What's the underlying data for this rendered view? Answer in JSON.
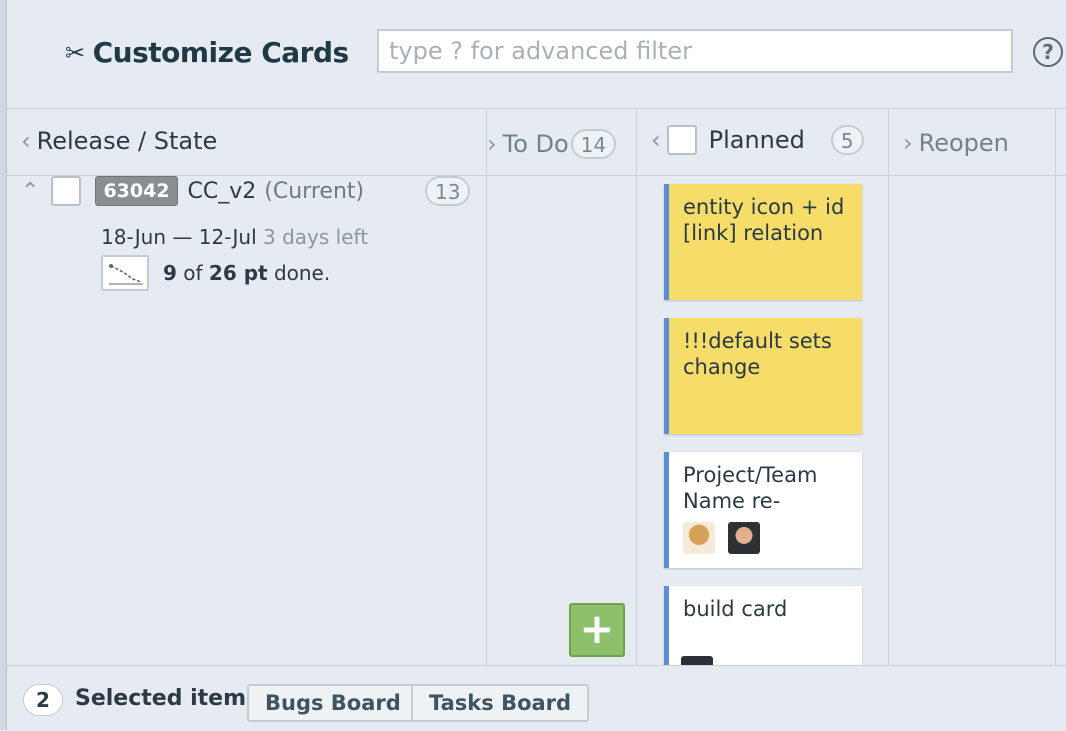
{
  "header": {
    "title": "Customize Cards",
    "title_icon": "scissors-icon",
    "filter_placeholder": "type ? for advanced filter",
    "help_label": "?"
  },
  "columns": {
    "release_state": {
      "label": "Release / State"
    },
    "todo": {
      "label": "To Do",
      "count": "14"
    },
    "planned": {
      "label": "Planned",
      "count": "5"
    },
    "reopen": {
      "label": "Reopen"
    }
  },
  "release": {
    "id": "63042",
    "name": "CC_v2",
    "status": "(Current)",
    "count": "13",
    "dates": "18-Jun — 12-Jul",
    "days_left": "3 days left",
    "done_current": "9",
    "done_of": " of ",
    "done_total": "26 pt",
    "done_suffix": " done."
  },
  "cards": [
    {
      "title": "entity icon + id [link] relation",
      "color": "#f6dd6a"
    },
    {
      "title": "!!!default sets change",
      "color": "#f6dd6a"
    },
    {
      "title": "Project/Team Name re-",
      "color": "#ffffff"
    },
    {
      "title": "build card",
      "color": "#ffffff"
    }
  ],
  "footer": {
    "selected_count": "2",
    "selected_label": "Selected items",
    "buttons": [
      "Bugs Board",
      "Tasks Board"
    ]
  },
  "colors": {
    "accent_blue": "#5a8fd6",
    "card_yellow": "#f6dd6a",
    "add_green": "#8ec06c"
  }
}
